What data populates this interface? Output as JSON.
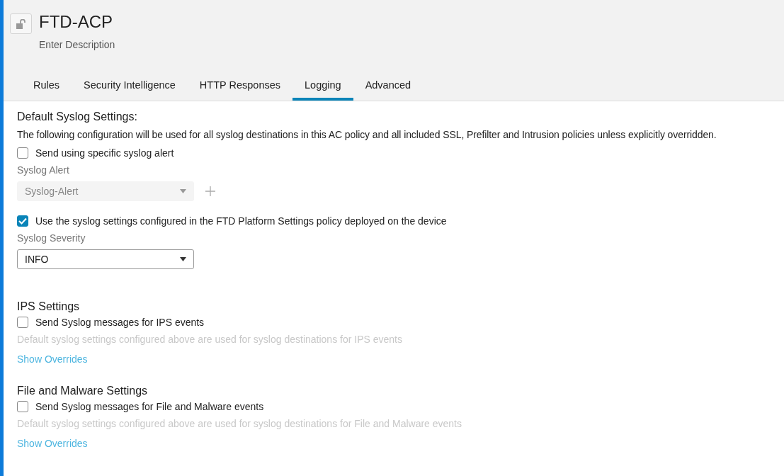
{
  "header": {
    "title": "FTD-ACP",
    "description": "Enter Description"
  },
  "tabs": [
    {
      "label": "Rules",
      "selected": false
    },
    {
      "label": "Security Intelligence",
      "selected": false
    },
    {
      "label": "HTTP Responses",
      "selected": false
    },
    {
      "label": "Logging",
      "selected": true
    },
    {
      "label": "Advanced",
      "selected": false
    }
  ],
  "default_syslog": {
    "heading": "Default Syslog Settings:",
    "description": "The following configuration will be used for all syslog destinations in this AC policy and all included SSL, Prefilter and Intrusion policies unless explicitly overridden.",
    "specific_alert": {
      "label": "Send using specific syslog alert",
      "checked": false
    },
    "syslog_alert": {
      "label": "Syslog Alert",
      "value": "Syslog-Alert",
      "disabled": true
    },
    "platform_settings": {
      "label": "Use the syslog settings configured in the FTD Platform Settings policy deployed on the device",
      "checked": true
    },
    "syslog_severity": {
      "label": "Syslog Severity",
      "value": "INFO",
      "disabled": false
    }
  },
  "sections": [
    {
      "heading": "IPS Settings",
      "checkbox": {
        "label": "Send Syslog messages for IPS events",
        "checked": false
      },
      "note": "Default syslog settings configured above are used for syslog destinations for IPS events",
      "link": "Show Overrides"
    },
    {
      "heading": "File and Malware Settings",
      "checkbox": {
        "label": "Send Syslog messages for File and Malware events",
        "checked": false
      },
      "note": "Default syslog settings configured above are used for syslog destinations for File and Malware events",
      "link": "Show Overrides"
    }
  ]
}
